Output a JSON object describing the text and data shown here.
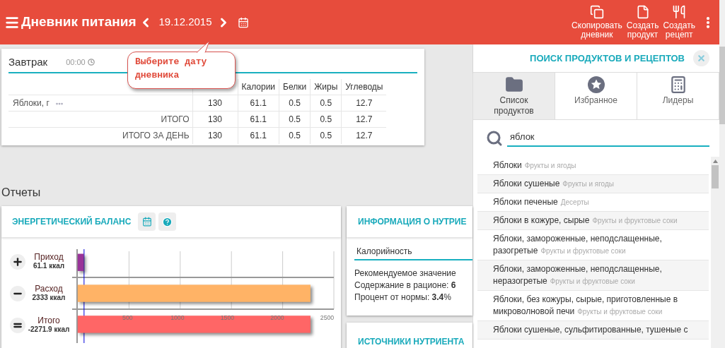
{
  "header": {
    "title": "Дневник питания",
    "date": "19.12.2015",
    "actions": [
      {
        "label": "Скопировать дневник",
        "kind": "copy"
      },
      {
        "label": "Создать продукт",
        "kind": "product"
      },
      {
        "label": "Создать рецепт",
        "kind": "recipe"
      }
    ]
  },
  "tooltip": {
    "text": "Выберите дату дневника"
  },
  "meal": {
    "title": "Завтрак",
    "time": "00:00",
    "columns": [
      "",
      "",
      "Калории",
      "Белки",
      "Жиры",
      "Углеводы"
    ],
    "rows": [
      {
        "kind": "item",
        "cells": [
          "Яблоки, г",
          "130",
          "61.1",
          "0.5",
          "0.5",
          "12.7"
        ]
      },
      {
        "kind": "total",
        "cells": [
          "ИТОГО",
          "130",
          "61.1",
          "0.5",
          "0.5",
          "12.7"
        ]
      },
      {
        "kind": "total",
        "cells": [
          "ИТОГО ЗА ДЕНЬ",
          "130",
          "61.1",
          "0.5",
          "0.5",
          "12.7"
        ]
      }
    ]
  },
  "reports": {
    "title": "Отчеты"
  },
  "energy_balance": {
    "title": "ЭНЕРГЕТИЧЕСКИЙ БАЛАНС",
    "rows": [
      {
        "value": "61.1 ккал",
        "kind": "plus",
        "color": "#993399"
      },
      {
        "value": "2333 ккал",
        "kind": "minus",
        "color": "#ffb366"
      },
      {
        "value": "-2271.9 ккал",
        "kind": "equal",
        "color": "#ff6666"
      }
    ],
    "chart_data": {
      "type": "bar",
      "orientation": "horizontal",
      "categories": [
        "Приход",
        "Расход",
        "Итого"
      ],
      "values": [
        61,
        2333,
        2333
      ],
      "xlim": [
        0,
        2500
      ],
      "xticks": [
        500,
        1000,
        1500,
        2000,
        2500
      ]
    }
  },
  "nutrient_info": {
    "title": "ИНФОРМАЦИЯ О НУТРИЕ",
    "field": "Калорийность",
    "lines": [
      "Рекомендуемое значение",
      "Содержание в рационе: **6**",
      "Процент от нормы: **3.4**%"
    ]
  },
  "nutrient_sources": {
    "title": "ИСТОЧНИКИ НУТРИЕНТА"
  },
  "search_panel": {
    "title": "ПОИСК ПРОДУКТОВ И РЕЦЕПТОВ",
    "tabs": [
      {
        "label": "Список продуктов",
        "kind": "list",
        "selected": true
      },
      {
        "label": "Избранное",
        "kind": "favorites",
        "selected": false
      },
      {
        "label": "Лидеры",
        "kind": "leaders",
        "selected": false
      }
    ],
    "query": "яблок",
    "results": [
      {
        "name": "Яблоки",
        "category": "Фрукты и ягоды"
      },
      {
        "name": "Яблоки сушеные",
        "category": "Фрукты и ягоды"
      },
      {
        "name": "Яблоки печеные",
        "category": "Десерты"
      },
      {
        "name": "Яблоки в кожуре, сырые",
        "category": "Фрукты и фруктовые соки"
      },
      {
        "name": "Яблоки, замороженные, неподслащенные, разогретые",
        "category": "Фрукты и фруктовые соки"
      },
      {
        "name": "Яблоки, замороженные, неподслащенные, неразогретые",
        "category": "Фрукты и фруктовые соки"
      },
      {
        "name": "Яблоки, без кожуры, сырые, приготовленные в микроволновой печи",
        "category": "Фрукты и фруктовые соки"
      },
      {
        "name": "Яблоки сушеные, сульфитированные, тушеные с"
      }
    ]
  }
}
